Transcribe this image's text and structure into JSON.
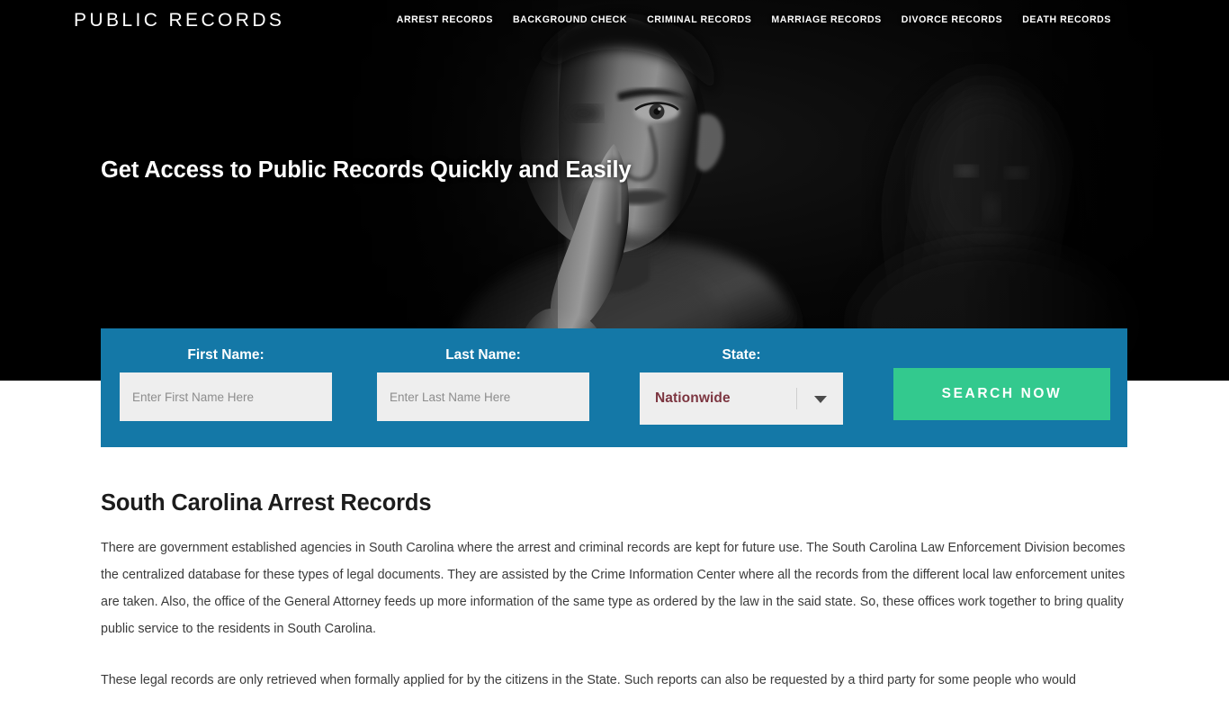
{
  "site": {
    "logo": "PUBLIC RECORDS",
    "accent_blue": "#1478a7",
    "accent_green": "#33c98e",
    "hero_background": "#000000",
    "select_text_color": "#7c3540"
  },
  "nav": {
    "items": [
      {
        "label": "ARREST RECORDS"
      },
      {
        "label": "BACKGROUND CHECK"
      },
      {
        "label": "CRIMINAL RECORDS"
      },
      {
        "label": "MARRIAGE RECORDS"
      },
      {
        "label": "DIVORCE RECORDS"
      },
      {
        "label": "DEATH RECORDS"
      }
    ]
  },
  "hero": {
    "headline": "Get Access to Public Records Quickly and Easily"
  },
  "search_form": {
    "first_name": {
      "label": "First Name:",
      "placeholder": "Enter First Name Here",
      "value": ""
    },
    "last_name": {
      "label": "Last Name:",
      "placeholder": "Enter Last Name Here",
      "value": ""
    },
    "state": {
      "label": "State:",
      "selected": "Nationwide"
    },
    "submit_label": "SEARCH NOW"
  },
  "article": {
    "title": "South Carolina Arrest Records",
    "paragraphs": [
      "There are government established agencies in South Carolina where the arrest and criminal records are kept for future use. The South Carolina Law Enforcement Division becomes the centralized database for these types of legal documents. They are assisted by the Crime Information Center where all the records from the different local law enforcement unites are taken. Also, the office of the General Attorney feeds up more information of the same type as ordered by the law in the said state. So, these offices work together to bring quality public service to the residents in South Carolina.",
      "These legal records are only retrieved when formally applied for by the citizens in the State. Such reports can also be requested by a third party for some people who would"
    ]
  }
}
